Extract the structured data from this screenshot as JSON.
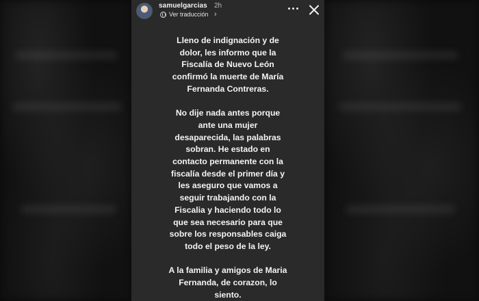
{
  "story": {
    "username": "samuelgarcias",
    "time": "2h",
    "translate_label": "Ver traducción",
    "icons": {
      "more": "more-options-icon",
      "close": "close-icon",
      "globe": "globe-icon",
      "chevron": "chevron-right-icon"
    },
    "paragraphs": [
      {
        "lines": [
          "Lleno de indignación y de",
          "dolor, les informo que la",
          "Fiscalía de Nuevo León",
          "confirmó la muerte de María",
          "Fernanda Contreras."
        ]
      },
      {
        "lines": [
          "No dije nada antes porque",
          "ante una mujer",
          "desaparecida, las palabras",
          "sobran. He estado en",
          "contacto permanente con la",
          "fiscalía desde el primer día y",
          "les aseguro que vamos a",
          "seguir trabajando con la",
          "Fiscalia y haciendo todo lo",
          "que sea necesario para que",
          "sobre los responsables caiga",
          "todo el peso de la ley."
        ]
      },
      {
        "lines": [
          "A la familia y amigos de Maria",
          "Fernanda, de corazon, lo",
          "siento."
        ]
      }
    ]
  },
  "colors": {
    "story_background": "#2a2a2a",
    "text": "#f4f4f4",
    "page_background": "#0a0a0a"
  }
}
